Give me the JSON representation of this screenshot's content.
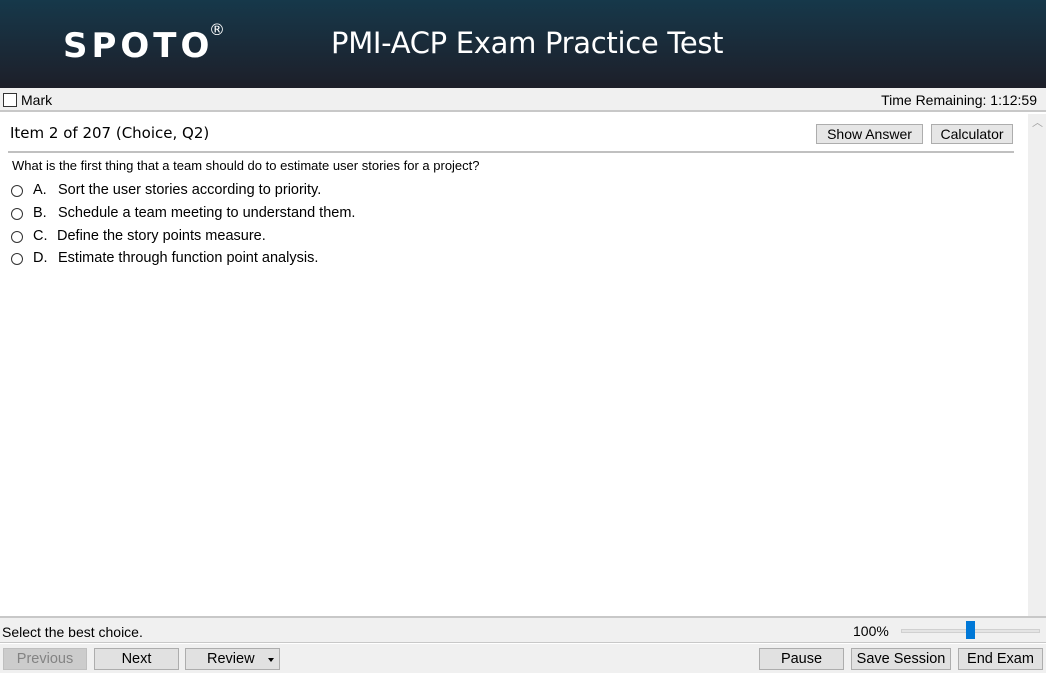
{
  "header": {
    "logo": "SPOTO",
    "logo_mark": "®",
    "title": "PMI-ACP Exam Practice Test"
  },
  "markbar": {
    "mark_label": "Mark",
    "mark_checked": false,
    "time_remaining": "Time Remaining: 1:12:59"
  },
  "item": {
    "title": "Item 2 of 207 (Choice, Q2)",
    "show_answer_label": "Show Answer",
    "calculator_label": "Calculator",
    "question": "What is the first thing that a team should do to estimate user stories for a project?",
    "options": [
      {
        "letter": "A.",
        "text": "Sort the user stories according to priority."
      },
      {
        "letter": "B.",
        "text": "Schedule a team meeting to understand them."
      },
      {
        "letter": "C.",
        "text": "Define the story points measure."
      },
      {
        "letter": "D.",
        "text": "Estimate through function point analysis."
      }
    ]
  },
  "scrollbar": {
    "up_icon": "chevron-up-icon"
  },
  "status": {
    "instruction": "Select the best choice.",
    "zoom_label": "100%",
    "zoom_slider_percent": 50
  },
  "nav": {
    "previous_label": "Previous",
    "next_label": "Next",
    "review_label": "Review",
    "pause_label": "Pause",
    "save_session_label": "Save Session",
    "end_exam_label": "End Exam"
  },
  "colors": {
    "header_top": "#16384a",
    "header_bottom": "#1d1f29",
    "slider_thumb": "#0078d7"
  }
}
